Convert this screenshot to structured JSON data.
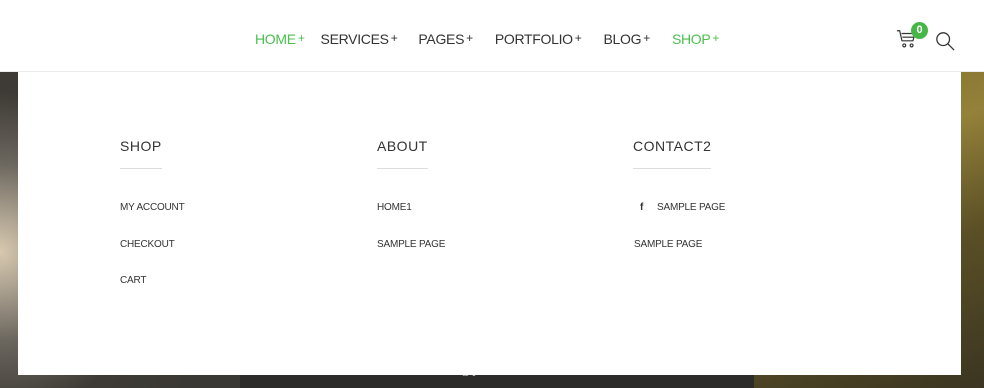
{
  "nav": {
    "items": [
      {
        "label": "HOME",
        "plus": "+",
        "active": true
      },
      {
        "label": "SERVICES",
        "plus": "+",
        "active": false
      },
      {
        "label": "PAGES",
        "plus": "+",
        "active": false
      },
      {
        "label": "PORTFOLIO",
        "plus": "+",
        "active": false
      },
      {
        "label": "BLOG",
        "plus": "+",
        "active": false
      },
      {
        "label": "SHOP",
        "plus": "+",
        "active": true
      }
    ],
    "active_color": "#4cbf4f",
    "text_color": "#333333"
  },
  "cart": {
    "icon": "cart-icon",
    "count": "0",
    "badge_color": "#46b648"
  },
  "search": {
    "icon": "search-icon"
  },
  "mega_menu": {
    "columns": [
      {
        "title": "SHOP",
        "links": [
          "MY ACCOUNT",
          "CHECKOUT",
          "CART"
        ]
      },
      {
        "title": "ABOUT",
        "links": [
          "HOME1",
          "SAMPLE PAGE"
        ]
      },
      {
        "title": "CONTACT2",
        "links": [
          "SAMPLE PAGE",
          "SAMPLE PAGE"
        ],
        "first_link_icon": "facebook-icon",
        "first_link_icon_glyph": "f"
      }
    ]
  },
  "hero": {
    "caption": "g y"
  }
}
